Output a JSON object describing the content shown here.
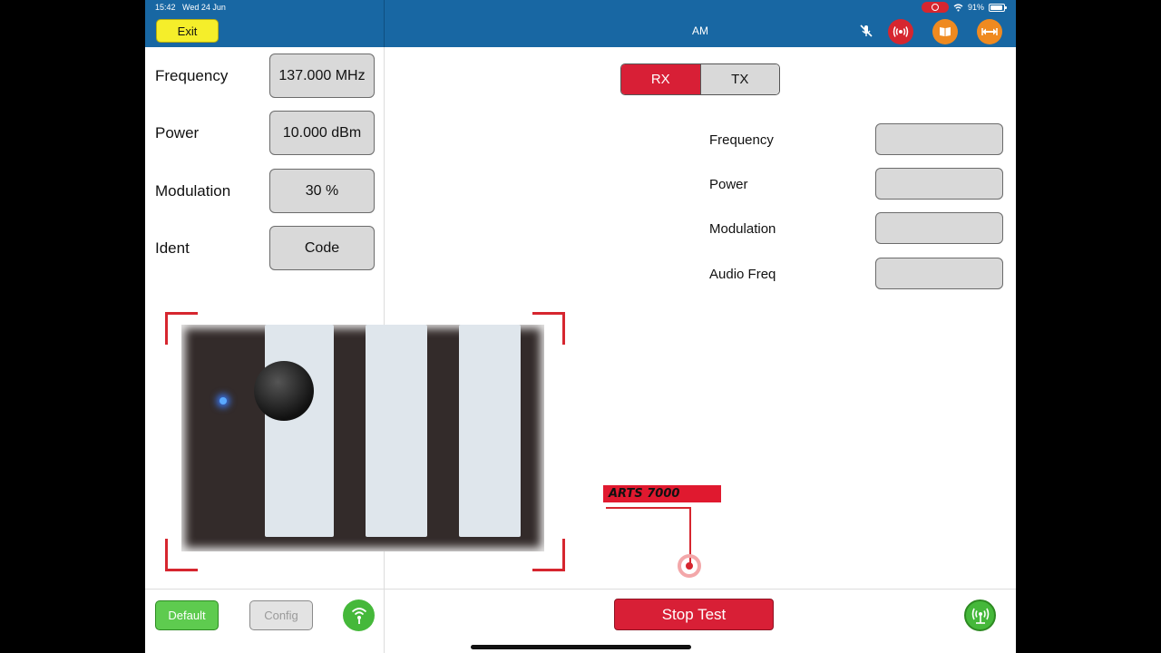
{
  "status_bar": {
    "time": "15:42",
    "date": "Wed 24 Jun",
    "battery": "91%",
    "battery_level": 0.91
  },
  "header": {
    "exit_label": "Exit",
    "mode_title": "AM",
    "icons": [
      "mute-icon",
      "radio-signal-icon",
      "book-icon",
      "resize-arrows-icon"
    ]
  },
  "generator": {
    "params": [
      {
        "label": "Frequency",
        "value": "137.000 MHz"
      },
      {
        "label": "Power",
        "value": "10.000 dBm"
      },
      {
        "label": "Modulation",
        "value": "30 %"
      },
      {
        "label": "Ident",
        "value": "Code"
      }
    ]
  },
  "measure": {
    "tabs": [
      {
        "label": "RX",
        "active": true
      },
      {
        "label": "TX",
        "active": false
      }
    ],
    "fields": [
      {
        "label": "Frequency",
        "value": ""
      },
      {
        "label": "Power",
        "value": ""
      },
      {
        "label": "Modulation",
        "value": ""
      },
      {
        "label": "Audio Freq",
        "value": ""
      }
    ]
  },
  "ar_marker": {
    "label": "ARTS 7000"
  },
  "footer": {
    "default_label": "Default",
    "config_label": "Config",
    "stop_label": "Stop Test"
  },
  "colors": {
    "header_blue": "#1867a3",
    "accent_red": "#d81f36",
    "exit_yellow": "#f5ee2a",
    "action_green": "#5ecb4f",
    "icon_orange": "#ef8a20"
  }
}
